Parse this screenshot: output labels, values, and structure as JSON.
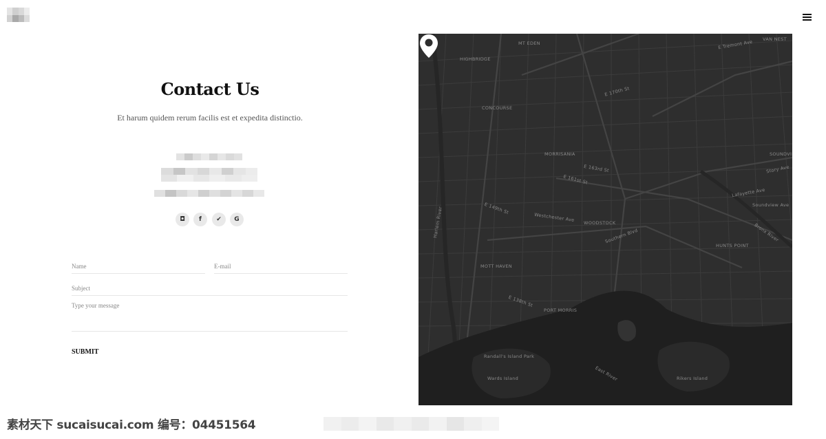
{
  "header": {
    "logo_icon": "brand-logo-blurred",
    "menu_icon": "hamburger-menu-icon"
  },
  "contact": {
    "title": "Contact Us",
    "subtitle": "Et harum quidem rerum facilis est et expedita distinctio."
  },
  "social": [
    {
      "icon": "instagram-icon",
      "glyph": "◘"
    },
    {
      "icon": "facebook-icon",
      "glyph": "f"
    },
    {
      "icon": "twitter-icon",
      "glyph": "✔"
    },
    {
      "icon": "google-icon",
      "glyph": "G"
    }
  ],
  "form": {
    "name_placeholder": "Name",
    "email_placeholder": "E-mail",
    "subject_placeholder": "Subject",
    "message_placeholder": "Type your message",
    "submit_label": "SUBMIT"
  },
  "map": {
    "pin_icon": "map-pin-icon",
    "labels": {
      "mt_eden": "MT EDEN",
      "highbridge": "HIGHBRIDGE",
      "concourse": "CONCOURSE",
      "morrisania": "MORRISANIA",
      "woodstock": "WOODSTOCK",
      "mott_haven": "MOTT HAVEN",
      "port_morris": "PORT MORRIS",
      "hunts_point": "HUNTS POINT",
      "van_nest": "VAN NEST",
      "soundview": "SOUNDVIEW",
      "randalls_island": "Randall's Island Park",
      "wards_island": "Wards Island",
      "rikers_island": "Rikers Island",
      "east_river": "East River",
      "harlem_river": "Harlem River",
      "bronx_river": "Bronx River",
      "southern_blvd": "Southern Blvd",
      "westchester_ave": "Westchester Ave",
      "lafayette_ave": "Lafayette Ave",
      "e_138th_st": "E 138th St",
      "e_149th_st": "E 149th St",
      "e_161st_st": "E 161st St",
      "e_163rd_st": "E 163rd St",
      "e_170th_st": "E 170th St",
      "e_tremont_ave": "E Tremont Ave",
      "story_ave": "Story Ave",
      "soundview_ave": "Soundview Ave"
    }
  },
  "watermark": "素材天下 sucaisucai.com   编号：04451564"
}
